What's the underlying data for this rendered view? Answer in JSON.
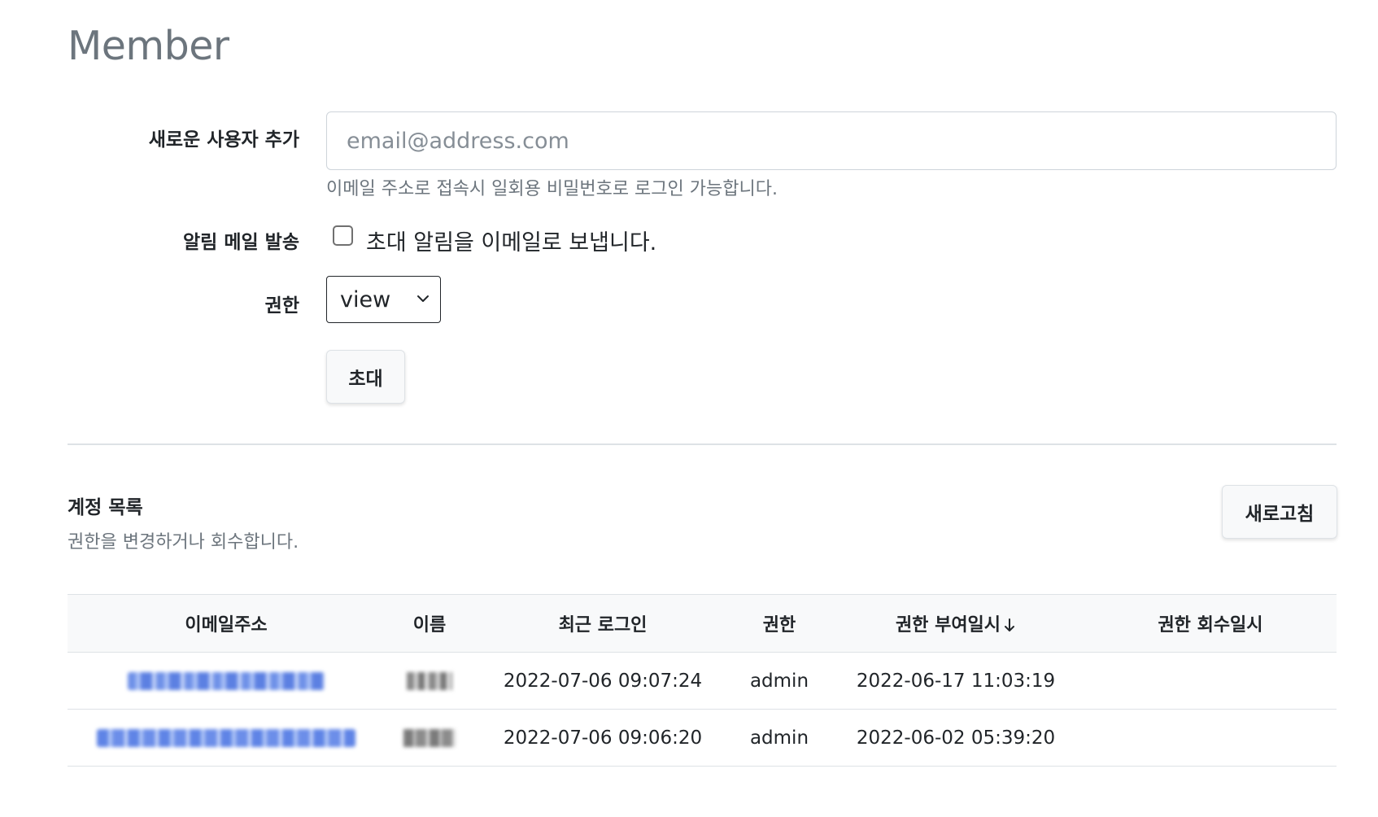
{
  "page": {
    "title": "Member"
  },
  "invite_form": {
    "new_user_label": "새로운 사용자 추가",
    "email_placeholder": "email@address.com",
    "email_value": "",
    "email_help": "이메일 주소로 접속시 일회용 비밀번호로 로그인 가능합니다.",
    "notify_label": "알림 메일 발송",
    "notify_checkbox_label": "초대 알림을 이메일로 보냅니다.",
    "notify_checked": false,
    "role_label": "권한",
    "role_selected": "view",
    "invite_button": "초대"
  },
  "accounts": {
    "title": "계정 목록",
    "subtitle": "권한을 변경하거나 회수합니다.",
    "refresh_button": "새로고침",
    "columns": {
      "email": "이메일주소",
      "name": "이름",
      "last_login": "최근 로그인",
      "role": "권한",
      "granted_at": "권한 부여일시",
      "revoked_at": "권한 회수일시"
    },
    "sort_indicator": "arrow-down-icon",
    "rows": [
      {
        "last_login": "2022-07-06 09:07:24",
        "role": "admin",
        "granted_at": "2022-06-17 11:03:19",
        "revoked_at": ""
      },
      {
        "last_login": "2022-07-06 09:06:20",
        "role": "admin",
        "granted_at": "2022-06-02 05:39:20",
        "revoked_at": ""
      }
    ]
  },
  "colors": {
    "title_gray": "#6c757d",
    "border": "#dee2e6",
    "header_bg": "#f8f9fa",
    "link_blue": "#0d6efd"
  }
}
